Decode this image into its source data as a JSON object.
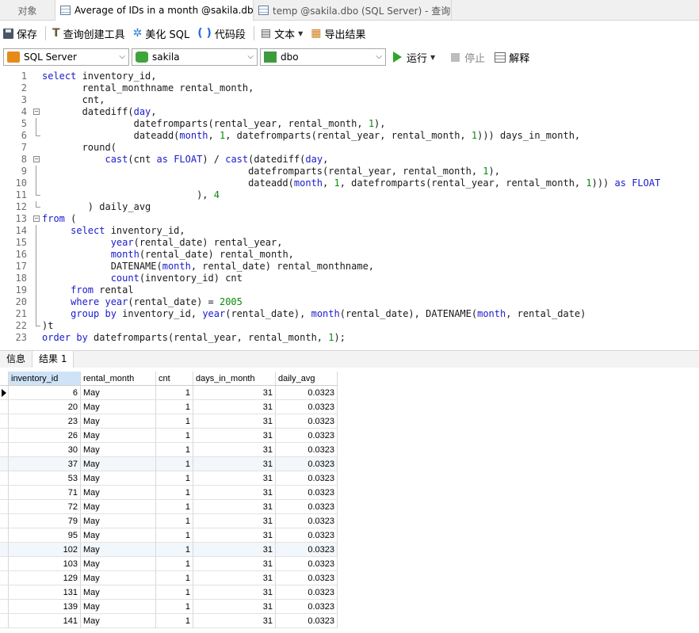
{
  "tabs": {
    "objects": "对象",
    "active": "Average of IDs in a month @sakila.dbo (...",
    "inactive": "temp @sakila.dbo (SQL Server) - 查询"
  },
  "toolbar": {
    "save": "保存",
    "query_builder": "查询创建工具",
    "beautify": "美化 SQL",
    "snippet": "代码段",
    "text": "文本",
    "export": "导出结果"
  },
  "selectors": {
    "connection": "SQL Server",
    "database": "sakila",
    "schema": "dbo",
    "run": "运行",
    "stop": "停止",
    "explain": "解释"
  },
  "editor": {
    "line_numbers": [
      "1",
      "2",
      "3",
      "4",
      "5",
      "6",
      "7",
      "8",
      "9",
      "10",
      "11",
      "12",
      "13",
      "14",
      "15",
      "16",
      "17",
      "18",
      "19",
      "20",
      "21",
      "22",
      "23"
    ]
  },
  "result_tabs": {
    "info": "信息",
    "result": "结果 1"
  },
  "grid": {
    "columns": [
      "inventory_id",
      "rental_month",
      "cnt",
      "days_in_month",
      "daily_avg"
    ],
    "rows": [
      [
        "6",
        "May",
        "1",
        "31",
        "0.0323"
      ],
      [
        "20",
        "May",
        "1",
        "31",
        "0.0323"
      ],
      [
        "23",
        "May",
        "1",
        "31",
        "0.0323"
      ],
      [
        "26",
        "May",
        "1",
        "31",
        "0.0323"
      ],
      [
        "30",
        "May",
        "1",
        "31",
        "0.0323"
      ],
      [
        "37",
        "May",
        "1",
        "31",
        "0.0323"
      ],
      [
        "53",
        "May",
        "1",
        "31",
        "0.0323"
      ],
      [
        "71",
        "May",
        "1",
        "31",
        "0.0323"
      ],
      [
        "72",
        "May",
        "1",
        "31",
        "0.0323"
      ],
      [
        "79",
        "May",
        "1",
        "31",
        "0.0323"
      ],
      [
        "95",
        "May",
        "1",
        "31",
        "0.0323"
      ],
      [
        "102",
        "May",
        "1",
        "31",
        "0.0323"
      ],
      [
        "103",
        "May",
        "1",
        "31",
        "0.0323"
      ],
      [
        "129",
        "May",
        "1",
        "31",
        "0.0323"
      ],
      [
        "131",
        "May",
        "1",
        "31",
        "0.0323"
      ],
      [
        "139",
        "May",
        "1",
        "31",
        "0.0323"
      ],
      [
        "141",
        "May",
        "1",
        "31",
        "0.0323"
      ]
    ]
  },
  "colors": {
    "keyword": "#1a1acc",
    "number": "#0a8a0a",
    "run": "#2ba82b"
  }
}
